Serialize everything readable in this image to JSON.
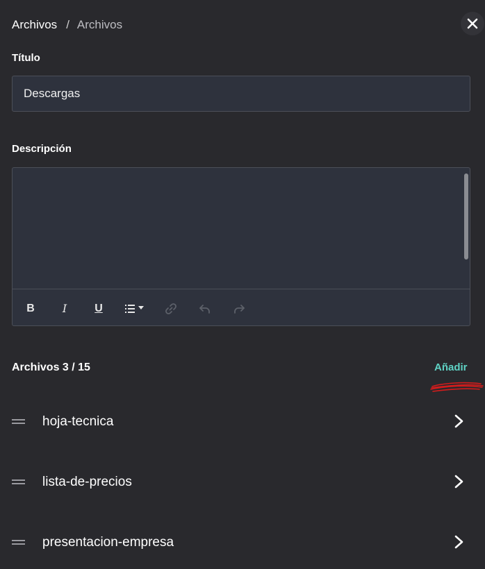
{
  "breadcrumb": {
    "root": "Archivos",
    "separator": "/",
    "current": "Archivos"
  },
  "icons": {
    "close": "close-icon",
    "bold": "bold-icon",
    "italic": "italic-icon",
    "underline": "underline-icon",
    "list": "list-icon",
    "link": "link-icon",
    "undo": "undo-icon",
    "redo": "redo-icon",
    "drag": "drag-handle-icon",
    "chevron": "chevron-right-icon"
  },
  "title_field": {
    "label": "Título",
    "value": "Descargas"
  },
  "description_field": {
    "label": "Descripción",
    "value": ""
  },
  "toolbar": {
    "bold": "B",
    "italic": "I",
    "underline": "U"
  },
  "files": {
    "heading": "Archivos 3 / 15",
    "add_label": "Añadir",
    "items": [
      {
        "name": "hoja-tecnica"
      },
      {
        "name": "lista-de-precios"
      },
      {
        "name": "presentacion-empresa"
      }
    ]
  },
  "colors": {
    "background": "#29292d",
    "input_bg": "#2e323d",
    "accent": "#5fd3c5",
    "annotation": "#d21c1c"
  }
}
